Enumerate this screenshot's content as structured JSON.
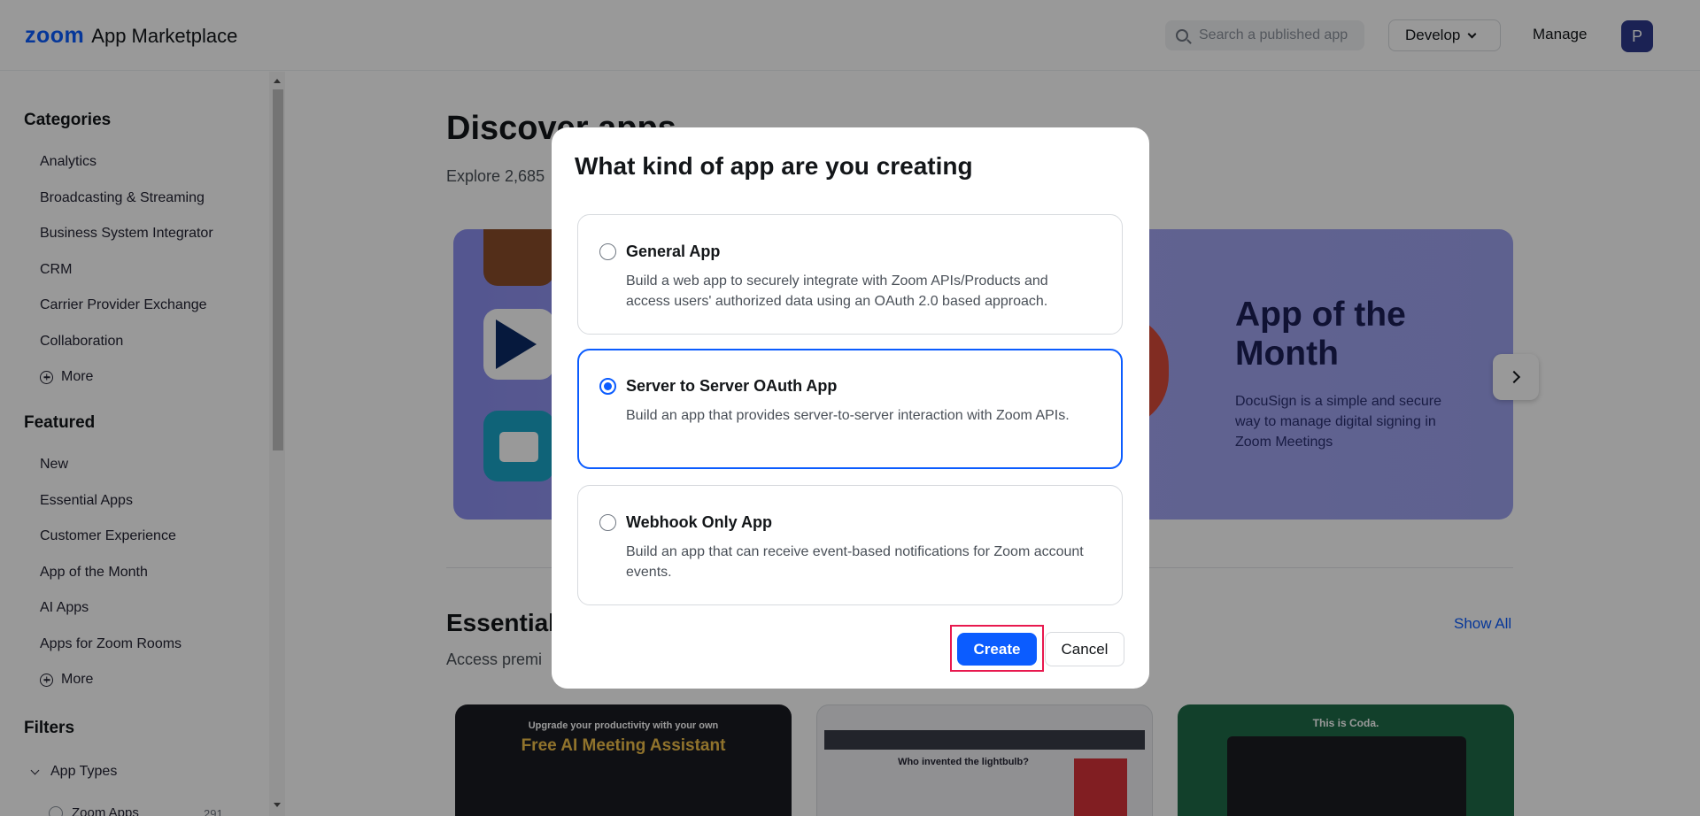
{
  "header": {
    "logo_brand": "zoom",
    "logo_text": "App Marketplace",
    "search_placeholder": "Search a published app",
    "develop_label": "Develop",
    "manage_label": "Manage",
    "avatar_initial": "P"
  },
  "sidebar": {
    "categories_title": "Categories",
    "categories": [
      "Analytics",
      "Broadcasting & Streaming",
      "Business System Integrator",
      "CRM",
      "Carrier Provider Exchange",
      "Collaboration"
    ],
    "categories_more": "More",
    "featured_title": "Featured",
    "featured": [
      "New",
      "Essential Apps",
      "Customer Experience",
      "App of the Month",
      "AI Apps",
      "Apps for Zoom Rooms"
    ],
    "featured_more": "More",
    "filters_title": "Filters",
    "app_types_label": "App Types",
    "zoom_apps_label": "Zoom Apps",
    "zoom_apps_count": "291"
  },
  "main": {
    "title": "Discover apps",
    "subtitle": "Explore 2,685",
    "hero": {
      "title": "App of the Month",
      "description": "DocuSign is a simple and secure way to manage digital signing in Zoom Meetings"
    },
    "section_title": "Essential",
    "section_subtitle": "Access premi",
    "show_all": "Show All",
    "cards": [
      {
        "top": "Upgrade your productivity with your own",
        "headline": "Free AI Meeting Assistant"
      },
      {
        "question": "Who invented the lightbulb?"
      },
      {
        "top": "This is Coda."
      }
    ]
  },
  "modal": {
    "title": "What kind of app are you creating",
    "options": [
      {
        "title": "General App",
        "description": "Build a web app to securely integrate with Zoom APIs/Products and access users' authorized data using an OAuth 2.0 based approach.",
        "selected": false
      },
      {
        "title": "Server to Server OAuth App",
        "description": "Build an app that provides server-to-server interaction with Zoom APIs.",
        "selected": true
      },
      {
        "title": "Webhook Only App",
        "description": "Build an app that can receive event-based notifications for Zoom account events.",
        "selected": false
      }
    ],
    "create_label": "Create",
    "cancel_label": "Cancel"
  },
  "colors": {
    "accent": "#0b5cff",
    "highlight": "#e8194e",
    "avatar": "#2d3a8c"
  }
}
